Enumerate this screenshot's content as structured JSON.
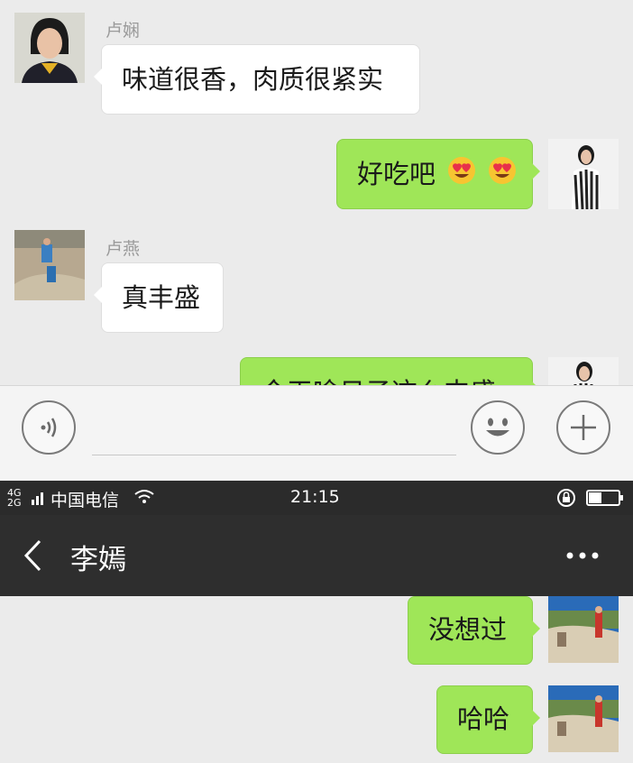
{
  "top_chat": {
    "messages": [
      {
        "sender": "卢娴",
        "text": "味道很香，肉质很紧实",
        "side": "left"
      },
      {
        "text": "好吃吧",
        "side": "right",
        "emojis": [
          "heart-eyes-emoji",
          "heart-eyes-emoji"
        ]
      },
      {
        "sender": "卢燕",
        "text": "真丰盛",
        "side": "left"
      },
      {
        "text": "今天啥日子这么丰盛",
        "side": "right",
        "truncated": true
      }
    ]
  },
  "input_bar": {
    "voice_icon": "voice-icon",
    "emoji_icon": "smiley-icon",
    "plus_icon": "plus-icon"
  },
  "status_bar": {
    "network": "4G 2G",
    "carrier": "中国电信",
    "time": "21:15"
  },
  "header": {
    "back_icon": "chevron-left-icon",
    "title": "李嫣",
    "more_icon": "more-icon"
  },
  "bottom_chat": {
    "messages": [
      {
        "text": "没想过",
        "side": "right"
      },
      {
        "text": "哈哈",
        "side": "right"
      }
    ]
  },
  "colors": {
    "chat_background": "#ebebeb",
    "sent_bubble": "#9fe658",
    "received_bubble": "#ffffff",
    "header_background": "#2e2e2e"
  }
}
